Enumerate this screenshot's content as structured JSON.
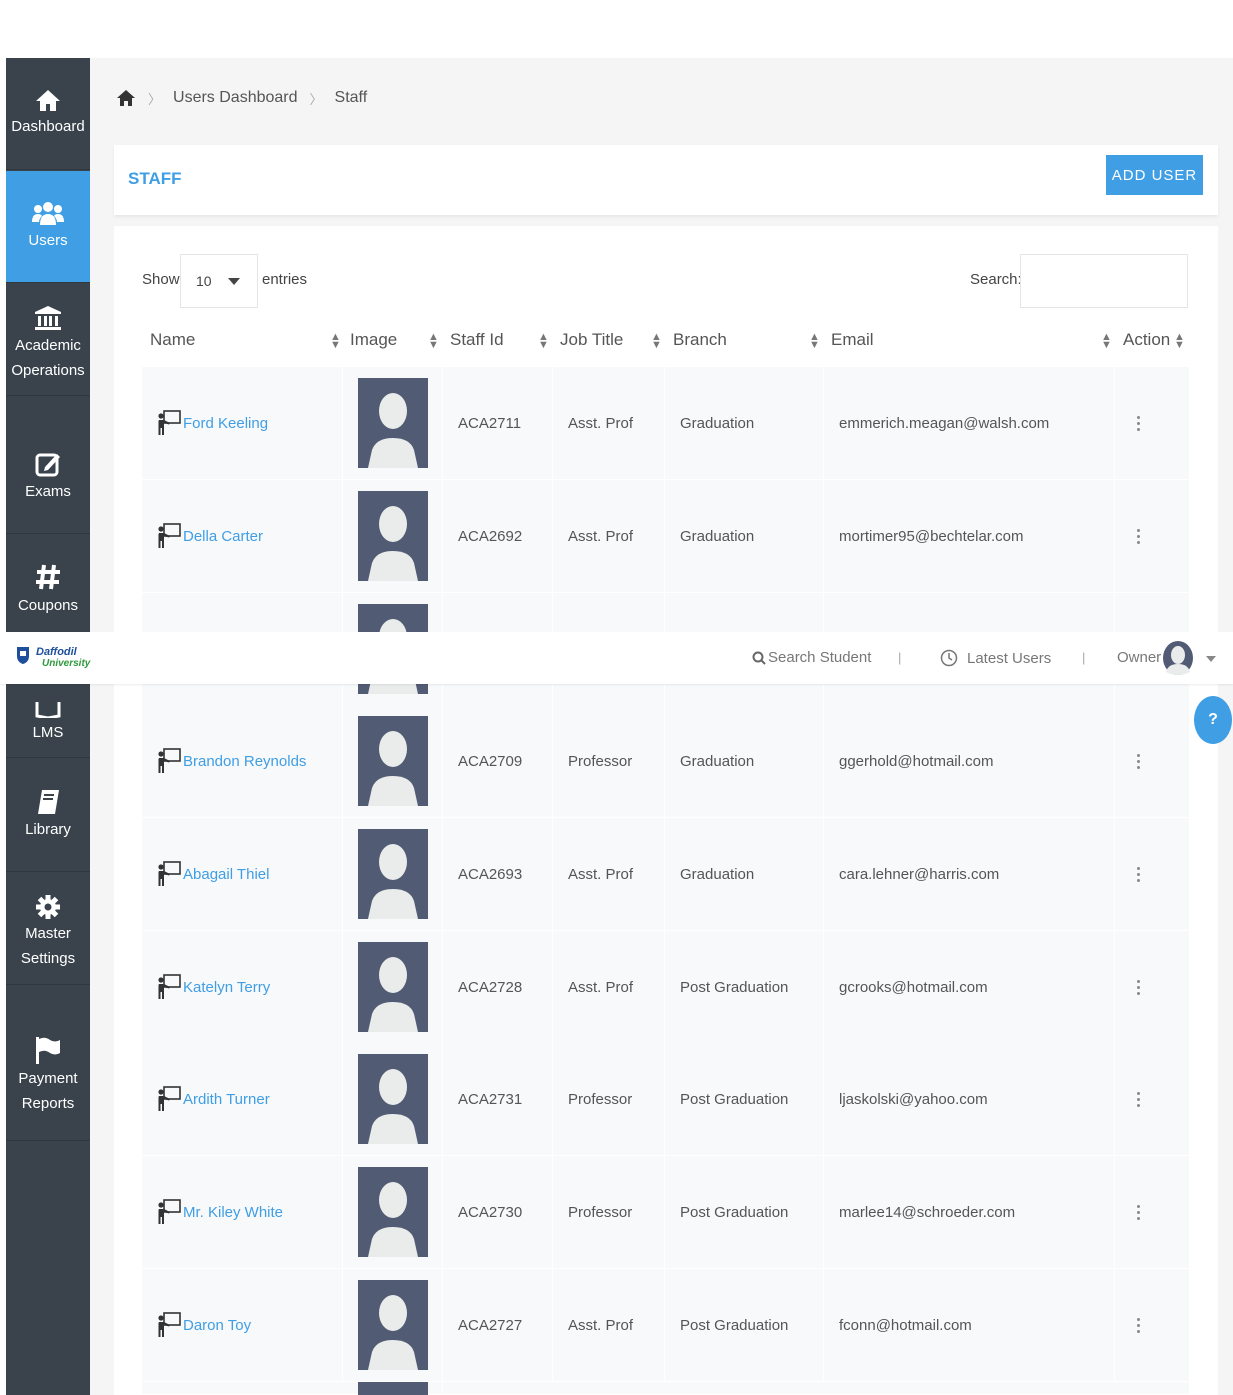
{
  "sidebar": {
    "items": [
      {
        "label": "Dashboard",
        "icon": "home-icon"
      },
      {
        "label": "Users",
        "icon": "users-icon"
      },
      {
        "label": "Academic\nOperations",
        "icon": "bank-icon"
      },
      {
        "label": "Exams",
        "icon": "edit-icon"
      },
      {
        "label": "Coupons",
        "icon": "hash-icon"
      },
      {
        "label": "LMS",
        "icon": "book-open-icon"
      },
      {
        "label": "Library",
        "icon": "book-icon"
      },
      {
        "label": "Master\nSettings",
        "icon": "gear-icon"
      },
      {
        "label": "Payment\nReports",
        "icon": "flag-icon"
      }
    ],
    "active": "Users"
  },
  "breadcrumb": {
    "home_icon": "home-icon",
    "items": [
      "Users Dashboard",
      "Staff"
    ]
  },
  "panel": {
    "title": "STAFF",
    "add_user_label": "ADD USER"
  },
  "table_controls": {
    "show_label": "Show",
    "page_length": "10",
    "entries_label": "entries",
    "search_label": "Search:",
    "search_value": ""
  },
  "table": {
    "columns": [
      "Name",
      "Image",
      "Staff Id",
      "Job Title",
      "Branch",
      "Email",
      "Action"
    ],
    "rows": [
      {
        "name": "Ford Keeling",
        "staff_id": "ACA2711",
        "job_title": "Asst. Prof",
        "branch": "Graduation",
        "email": "emmerich.meagan@walsh.com"
      },
      {
        "name": "Della Carter",
        "staff_id": "ACA2692",
        "job_title": "Asst. Prof",
        "branch": "Graduation",
        "email": "mortimer95@bechtelar.com"
      },
      {
        "name": "",
        "staff_id": "",
        "job_title": "",
        "branch": "",
        "email": ""
      },
      {
        "name": "Brandon Reynolds",
        "staff_id": "ACA2709",
        "job_title": "Professor",
        "branch": "Graduation",
        "email": "ggerhold@hotmail.com"
      },
      {
        "name": "Abagail Thiel",
        "staff_id": "ACA2693",
        "job_title": "Asst. Prof",
        "branch": "Graduation",
        "email": "cara.lehner@harris.com"
      },
      {
        "name": "Katelyn Terry",
        "staff_id": "ACA2728",
        "job_title": "Asst. Prof",
        "branch": "Post Graduation",
        "email": "gcrooks@hotmail.com"
      },
      {
        "name": "Ardith Turner",
        "staff_id": "ACA2731",
        "job_title": "Professor",
        "branch": "Post Graduation",
        "email": "ljaskolski@yahoo.com"
      },
      {
        "name": "Mr. Kiley White",
        "staff_id": "ACA2730",
        "job_title": "Professor",
        "branch": "Post Graduation",
        "email": "marlee14@schroeder.com"
      },
      {
        "name": "Daron Toy",
        "staff_id": "ACA2727",
        "job_title": "Asst. Prof",
        "branch": "Post Graduation",
        "email": "fconn@hotmail.com"
      }
    ]
  },
  "topbar": {
    "logo_line1": "Daffodil",
    "logo_line2": "University",
    "search_student": "Search Student",
    "latest_users": "Latest Users",
    "owner_label": "Owner"
  },
  "help_label": "?",
  "colors": {
    "accent": "#3f9ee4",
    "sidebar": "#3a434c",
    "avatar": "#525b74"
  }
}
